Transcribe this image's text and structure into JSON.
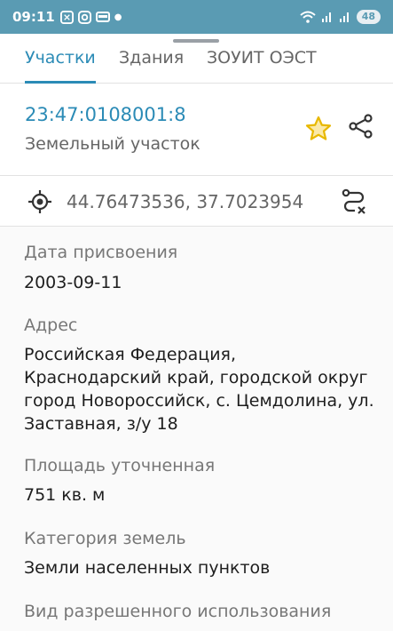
{
  "status_bar": {
    "time": "09:11",
    "battery": "48"
  },
  "tabs": [
    {
      "label": "Участки",
      "active": true
    },
    {
      "label": "Здания",
      "active": false
    },
    {
      "label": "ЗОУИТ ОЭСТ",
      "active": false
    }
  ],
  "parcel": {
    "cadastral_number": "23:47:0108001:8",
    "type": "Земельный участок"
  },
  "coordinates": "44.76473536, 37.7023954",
  "fields": [
    {
      "label": "Дата присвоения",
      "value": "2003-09-11"
    },
    {
      "label": "Адрес",
      "value": "Российская Федерация, Краснодарский край, городской округ город Новороссийск, с. Цемдолина, ул. Заставная, з/у 18"
    },
    {
      "label": "Площадь уточненная",
      "value": "751 кв. м"
    },
    {
      "label": "Категория земель",
      "value": "Земли населенных пунктов"
    },
    {
      "label": "Вид разрешенного использования",
      "value": ""
    }
  ],
  "colors": {
    "status_bar": "#5a9bb3",
    "accent": "#2b8bb6",
    "star": "#e8b800"
  },
  "icons": [
    "star-icon",
    "share-icon",
    "location-target-icon",
    "route-icon"
  ]
}
